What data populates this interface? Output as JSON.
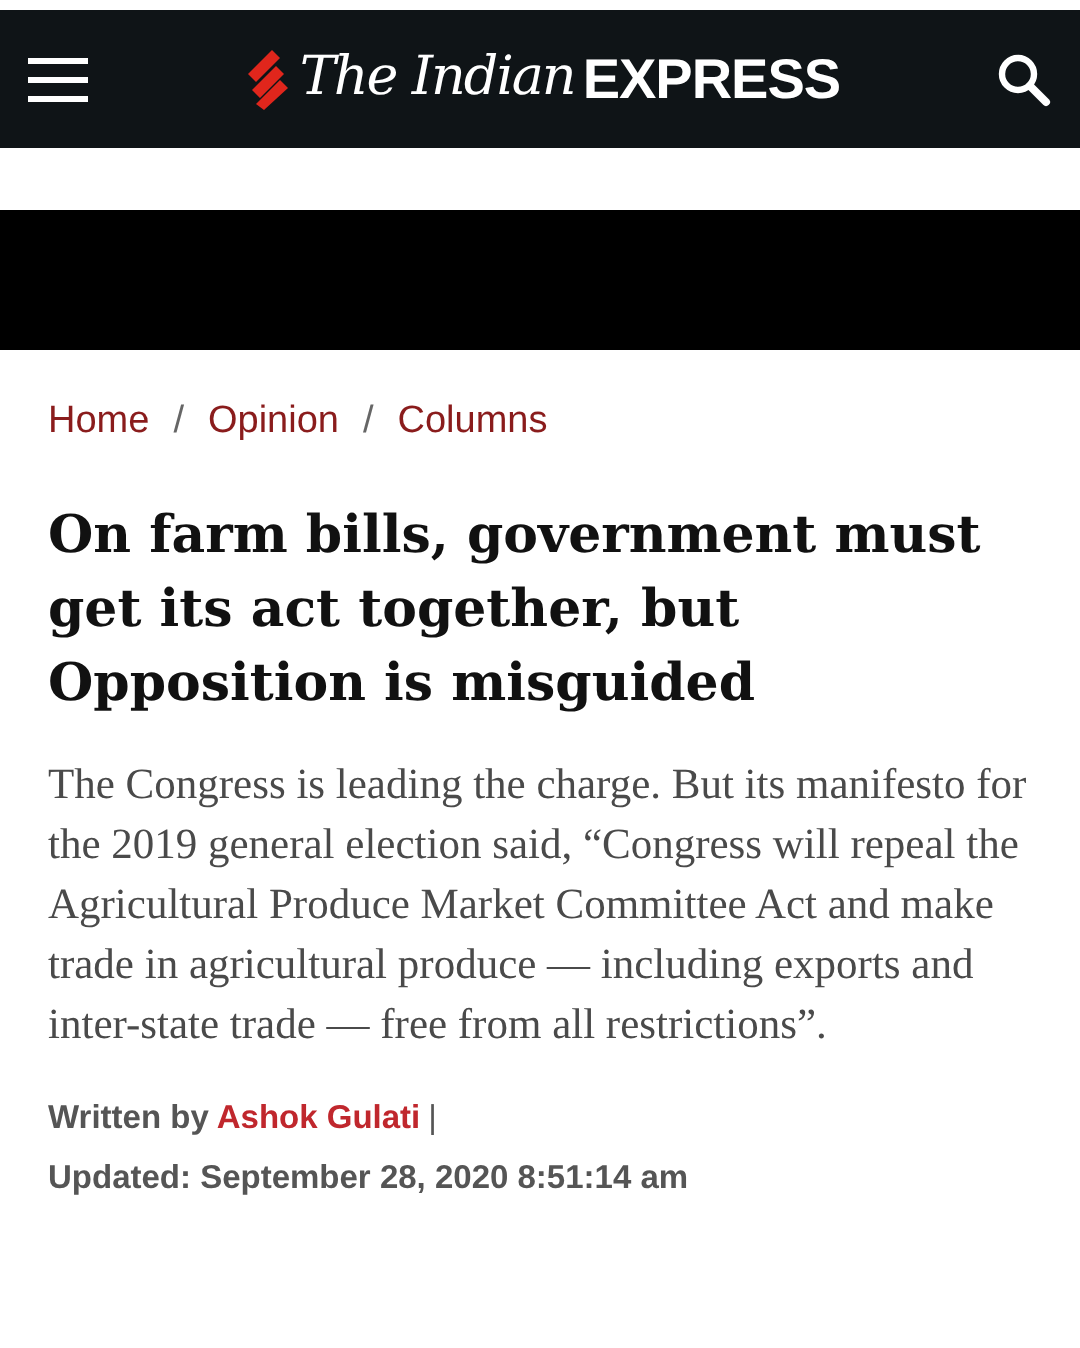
{
  "header": {
    "logo_italic": "The Indian",
    "logo_bold": "EXPRESS"
  },
  "breadcrumb": [
    "Home",
    "Opinion",
    "Columns"
  ],
  "breadcrumb_separator": "/",
  "headline": "On farm bills, government must get its act together, but Opposition is misguided",
  "summary": "The Congress is leading the charge. But its manifesto for the 2019 general election said, “Congress will repeal the Agricultural Produce Market Committee Act and make trade in agricultural produce — including exports and inter-state trade — free from all restrictions”.",
  "byline": {
    "label": "Written by",
    "author": "Ashok Gulati",
    "separator": "|"
  },
  "updated": "Updated: September 28, 2020 8:51:14 am"
}
